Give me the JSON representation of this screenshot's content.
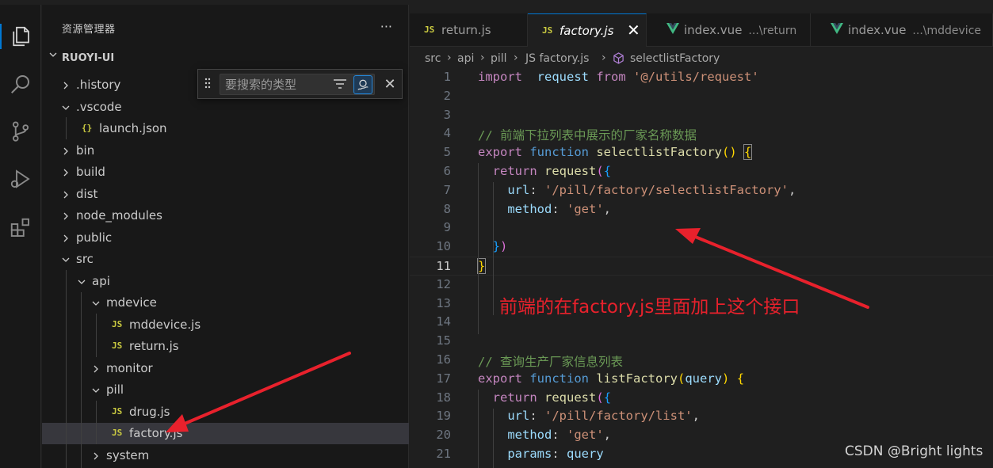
{
  "explorer": {
    "title": "资源管理器",
    "more": "···",
    "project": "RUOYI-UI",
    "tree": [
      {
        "label": ".history",
        "kind": "folder",
        "open": false,
        "depth": 0
      },
      {
        "label": ".vscode",
        "kind": "folder",
        "open": true,
        "depth": 0
      },
      {
        "label": "launch.json",
        "kind": "json",
        "depth": 1,
        "icon": "{}"
      },
      {
        "label": "bin",
        "kind": "folder",
        "open": false,
        "depth": 0
      },
      {
        "label": "build",
        "kind": "folder",
        "open": false,
        "depth": 0
      },
      {
        "label": "dist",
        "kind": "folder",
        "open": false,
        "depth": 0
      },
      {
        "label": "node_modules",
        "kind": "folder",
        "open": false,
        "depth": 0
      },
      {
        "label": "public",
        "kind": "folder",
        "open": false,
        "depth": 0
      },
      {
        "label": "src",
        "kind": "folder",
        "open": true,
        "depth": 0
      },
      {
        "label": "api",
        "kind": "folder",
        "open": true,
        "depth": 1
      },
      {
        "label": "mdevice",
        "kind": "folder",
        "open": true,
        "depth": 2
      },
      {
        "label": "mddevice.js",
        "kind": "js",
        "depth": 3,
        "icon": "JS"
      },
      {
        "label": "return.js",
        "kind": "js",
        "depth": 3,
        "icon": "JS"
      },
      {
        "label": "monitor",
        "kind": "folder",
        "open": false,
        "depth": 2
      },
      {
        "label": "pill",
        "kind": "folder",
        "open": true,
        "depth": 2
      },
      {
        "label": "drug.js",
        "kind": "js",
        "depth": 3,
        "icon": "JS"
      },
      {
        "label": "factory.js",
        "kind": "js",
        "depth": 3,
        "icon": "JS",
        "selected": true
      },
      {
        "label": "system",
        "kind": "folder",
        "open": false,
        "depth": 2
      }
    ]
  },
  "find": {
    "placeholder": "要搜索的类型",
    "close": "✕"
  },
  "tabs": [
    {
      "icon": "JS",
      "name": "return.js",
      "desc": "",
      "active": false
    },
    {
      "icon": "JS",
      "name": "factory.js",
      "desc": "",
      "active": true,
      "close": "✕"
    },
    {
      "icon": "vue",
      "name": "index.vue",
      "desc": "...\\return",
      "active": false
    },
    {
      "icon": "vue",
      "name": "index.vue",
      "desc": "...\\mddevice",
      "active": false
    }
  ],
  "breadcrumb": [
    "src",
    "api",
    "pill",
    "JS factory.js",
    "selectlistFactory"
  ],
  "editor": {
    "current_line": 11,
    "lines": [
      {
        "n": "1",
        "tokens": [
          [
            "kw",
            "import"
          ],
          [
            "",
            "  "
          ],
          [
            "var",
            "request"
          ],
          [
            "",
            " "
          ],
          [
            "kw",
            "from"
          ],
          [
            "",
            " "
          ],
          [
            "str",
            "'@/utils/request'"
          ]
        ]
      },
      {
        "n": "2",
        "tokens": []
      },
      {
        "n": "3",
        "tokens": []
      },
      {
        "n": "4",
        "tokens": [
          [
            "cmt",
            "// 前端下拉列表中展示的厂家名称数据"
          ]
        ]
      },
      {
        "n": "5",
        "tokens": [
          [
            "kw",
            "export"
          ],
          [
            "",
            " "
          ],
          [
            "kw2",
            "function"
          ],
          [
            "",
            " "
          ],
          [
            "fn",
            "selectlistFactory"
          ],
          [
            "br1",
            "()"
          ],
          [
            "",
            " "
          ],
          [
            "br1box",
            "{"
          ]
        ]
      },
      {
        "n": "6",
        "tokens": [
          [
            "",
            "  "
          ],
          [
            "kw",
            "return"
          ],
          [
            "",
            " "
          ],
          [
            "fn",
            "request"
          ],
          [
            "br2",
            "("
          ],
          [
            "br3",
            "{"
          ]
        ]
      },
      {
        "n": "7",
        "tokens": [
          [
            "",
            "    "
          ],
          [
            "var",
            "url"
          ],
          [
            "",
            ": "
          ],
          [
            "str",
            "'/pill/factory/selectlistFactory'"
          ],
          [
            "",
            ","
          ]
        ]
      },
      {
        "n": "8",
        "tokens": [
          [
            "",
            "    "
          ],
          [
            "var",
            "method"
          ],
          [
            "",
            ": "
          ],
          [
            "str",
            "'get'"
          ],
          [
            "",
            ","
          ]
        ]
      },
      {
        "n": "9",
        "tokens": []
      },
      {
        "n": "10",
        "tokens": [
          [
            "",
            "  "
          ],
          [
            "br3",
            "}"
          ],
          [
            "br2",
            ")"
          ]
        ]
      },
      {
        "n": "11",
        "tokens": [
          [
            "br1box",
            "}"
          ]
        ]
      },
      {
        "n": "12",
        "tokens": []
      },
      {
        "n": "13",
        "tokens": []
      },
      {
        "n": "14",
        "tokens": []
      },
      {
        "n": "15",
        "tokens": []
      },
      {
        "n": "16",
        "tokens": [
          [
            "cmt",
            "// 查询生产厂家信息列表"
          ]
        ]
      },
      {
        "n": "17",
        "tokens": [
          [
            "kw",
            "export"
          ],
          [
            "",
            " "
          ],
          [
            "kw2",
            "function"
          ],
          [
            "",
            " "
          ],
          [
            "fn",
            "listFactory"
          ],
          [
            "br1",
            "("
          ],
          [
            "var",
            "query"
          ],
          [
            "br1",
            ")"
          ],
          [
            "",
            " "
          ],
          [
            "br1",
            "{"
          ]
        ]
      },
      {
        "n": "18",
        "tokens": [
          [
            "",
            "  "
          ],
          [
            "kw",
            "return"
          ],
          [
            "",
            " "
          ],
          [
            "fn",
            "request"
          ],
          [
            "br2",
            "("
          ],
          [
            "br3",
            "{"
          ]
        ]
      },
      {
        "n": "19",
        "tokens": [
          [
            "",
            "    "
          ],
          [
            "var",
            "url"
          ],
          [
            "",
            ": "
          ],
          [
            "str",
            "'/pill/factory/list'"
          ],
          [
            "",
            ","
          ]
        ]
      },
      {
        "n": "20",
        "tokens": [
          [
            "",
            "    "
          ],
          [
            "var",
            "method"
          ],
          [
            "",
            ": "
          ],
          [
            "str",
            "'get'"
          ],
          [
            "",
            ","
          ]
        ]
      },
      {
        "n": "21",
        "tokens": [
          [
            "",
            "    "
          ],
          [
            "var",
            "params"
          ],
          [
            "",
            ": "
          ],
          [
            "var",
            "query"
          ]
        ]
      }
    ]
  },
  "annotation": "前端的在factory.js里面加上这个接口",
  "watermark": "CSDN @Bright lights",
  "colors": {
    "accent": "#0078d4",
    "annotation": "#e8212c",
    "js_icon": "#cbcb41",
    "vue_icon": "#41b883"
  }
}
